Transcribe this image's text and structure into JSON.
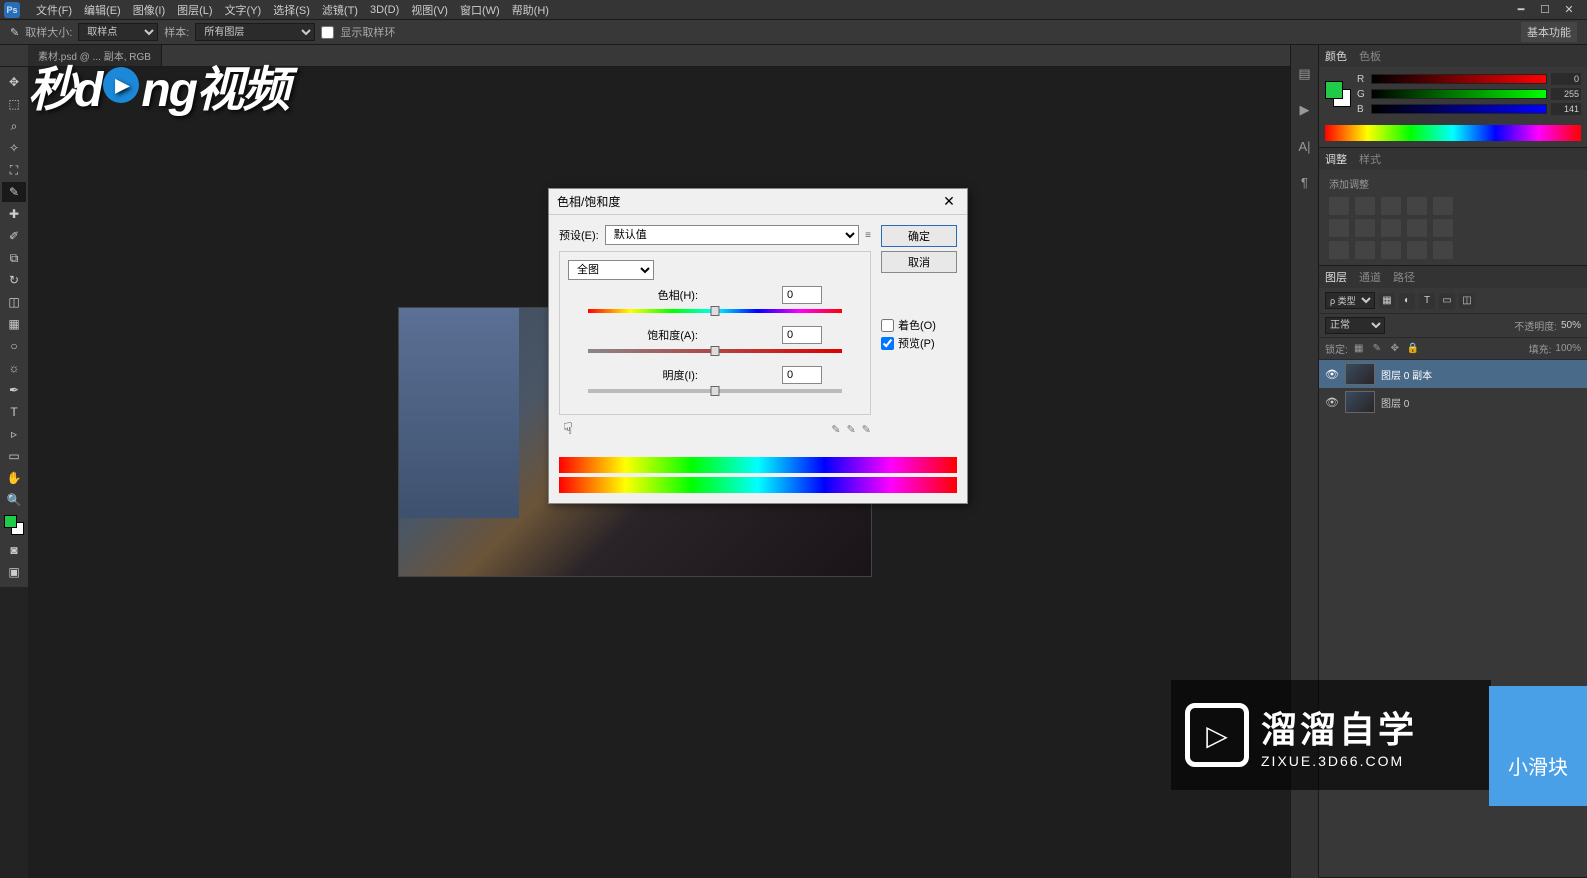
{
  "menu": {
    "items": [
      "文件(F)",
      "编辑(E)",
      "图像(I)",
      "图层(L)",
      "文字(Y)",
      "选择(S)",
      "滤镜(T)",
      "3D(D)",
      "视图(V)",
      "窗口(W)",
      "帮助(H)"
    ]
  },
  "options": {
    "sample_size_label": "取样大小:",
    "sample_size_value": "取样点",
    "sample_label": "样本:",
    "sample_value": "所有图层",
    "show_ring": "显示取样环",
    "workspace": "基本功能"
  },
  "doc_tab": "素材.psd @ ... 副本, RGB",
  "watermark": {
    "pre": "秒d",
    "post": "ng视频"
  },
  "dialog": {
    "title": "色相/饱和度",
    "preset_label": "预设(E):",
    "preset_value": "默认值",
    "range_value": "全图",
    "hue_label": "色相(H):",
    "hue_value": "0",
    "sat_label": "饱和度(A):",
    "sat_value": "0",
    "light_label": "明度(I):",
    "light_value": "0",
    "colorize": "着色(O)",
    "preview": "预览(P)",
    "ok": "确定",
    "cancel": "取消"
  },
  "color_panel": {
    "tabs": [
      "颜色",
      "色板"
    ],
    "r": {
      "lbl": "R",
      "val": "0"
    },
    "g": {
      "lbl": "G",
      "val": "255"
    },
    "b": {
      "lbl": "B",
      "val": "141"
    }
  },
  "adjust_panel": {
    "tabs": [
      "调整",
      "样式"
    ],
    "add_label": "添加调整"
  },
  "layers_panel": {
    "tabs": [
      "图层",
      "通道",
      "路径"
    ],
    "filter_kind": "ρ 类型",
    "blend_mode": "正常",
    "opacity_label": "不透明度:",
    "opacity_value": "50%",
    "lock_label": "锁定:",
    "fill_label": "填充:",
    "fill_value": "100%",
    "layers": [
      {
        "name": "图层 0 副本",
        "selected": true
      },
      {
        "name": "图层 0",
        "selected": false
      }
    ]
  },
  "brand": {
    "big": "溜溜自学",
    "sm": "ZIXUE.3D66.COM"
  },
  "tip": "小滑块"
}
